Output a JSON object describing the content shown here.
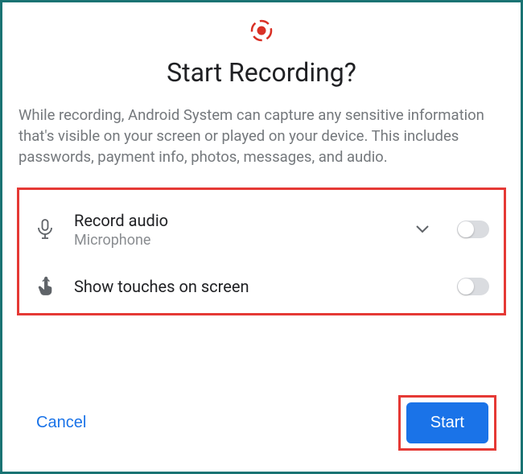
{
  "dialog": {
    "title": "Start Recording?",
    "body": "While recording, Android System can capture any sensitive information that's visible on your screen or played on your device. This includes passwords, payment info, photos, messages, and audio."
  },
  "options": {
    "record_audio": {
      "label": "Record audio",
      "sub": "Microphone",
      "enabled": false
    },
    "show_touches": {
      "label": "Show touches on screen",
      "enabled": false
    }
  },
  "buttons": {
    "cancel": "Cancel",
    "start": "Start"
  },
  "colors": {
    "accent": "#1a73e8",
    "highlight": "#e53935",
    "frame": "#1a7373"
  }
}
